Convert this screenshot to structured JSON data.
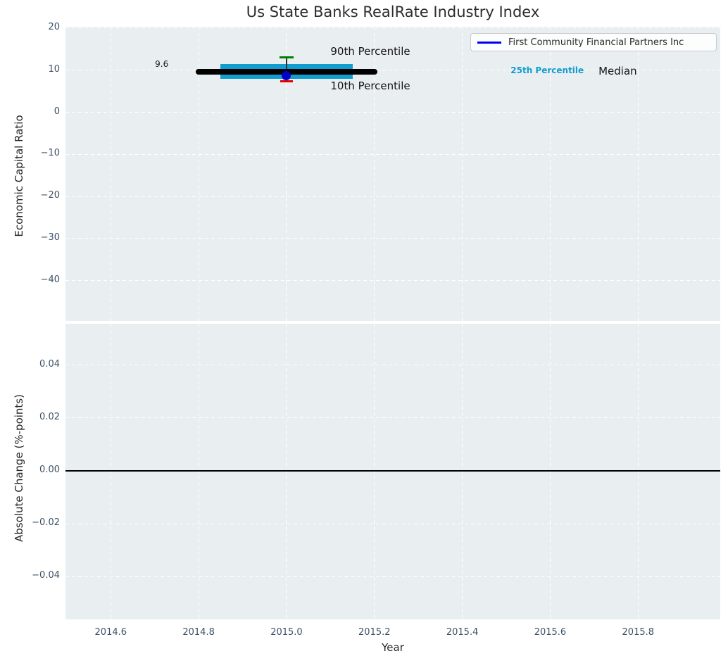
{
  "colors": {
    "plot_background": "#e9eef0",
    "grid": "#ffffff",
    "iqr_bar": "#109dd0",
    "median_line": "#000000",
    "p90_cap": "#008000",
    "p10_cap": "#e50000",
    "company_point": "#0000cd",
    "company_line": "#0000ee",
    "zero_line": "#000000",
    "whisker": "#2f2f2f"
  },
  "chart_data": [
    {
      "type": "box_timeline",
      "title": "Us State Banks RealRate Industry Index",
      "ylabel": "Economic Capital Ratio",
      "xlim": [
        2014.497,
        2015.987
      ],
      "ylim": [
        -49.6,
        20.33
      ],
      "grid": true,
      "legend": {
        "label": "First Community Financial Partners Inc",
        "position": "upper right"
      },
      "xticks": [
        {
          "v": 2014.6,
          "label": "2014.6"
        },
        {
          "v": 2014.8,
          "label": "2014.8"
        },
        {
          "v": 2015.0,
          "label": "2015.0"
        },
        {
          "v": 2015.2,
          "label": "2015.2"
        },
        {
          "v": 2015.4,
          "label": "2015.4"
        },
        {
          "v": 2015.6,
          "label": "2015.6"
        },
        {
          "v": 2015.8,
          "label": "2015.8"
        }
      ],
      "yticks": [
        {
          "v": 20,
          "label": "20"
        },
        {
          "v": 10,
          "label": "10"
        },
        {
          "v": 0,
          "label": "0"
        },
        {
          "v": -10,
          "label": "−10"
        },
        {
          "v": -20,
          "label": "−20"
        },
        {
          "v": -30,
          "label": "−30"
        },
        {
          "v": -40,
          "label": "−40"
        }
      ],
      "box": {
        "x": 2015.0,
        "median": {
          "value": 9.6,
          "x_from": 2014.8,
          "x_to": 2015.2
        },
        "iqr": {
          "p25": 8.0,
          "p75": 11.5,
          "x_from": 2014.85,
          "x_to": 2015.15
        },
        "whisker": {
          "p10": 7.4,
          "p90": 13.1
        },
        "point": {
          "x": 2015.0,
          "value": 8.7
        }
      },
      "annotations": [
        {
          "text": "9.6",
          "x": 2014.716,
          "y": 11.5,
          "align": "center",
          "style": "value"
        },
        {
          "text": "90th Percentile",
          "x": 2015.1,
          "y": 14.4,
          "align": "left",
          "style": "plain"
        },
        {
          "text": "10th Percentile",
          "x": 2015.1,
          "y": 6.3,
          "align": "left",
          "style": "plain"
        },
        {
          "text": "25th Percentile",
          "x": 2015.51,
          "y": 10.0,
          "align": "left",
          "style": "cyan"
        },
        {
          "text": "Median",
          "x": 2015.71,
          "y": 9.8,
          "align": "left",
          "style": "plain"
        }
      ]
    },
    {
      "type": "line",
      "ylabel": "Absolute Change (%-points)",
      "xlabel": "Year",
      "xlim": [
        2014.497,
        2015.987
      ],
      "ylim": [
        -0.0561,
        0.0556
      ],
      "grid": true,
      "zero_line": 0.0,
      "series": [],
      "xticks": [
        {
          "v": 2014.6,
          "label": "2014.6"
        },
        {
          "v": 2014.8,
          "label": "2014.8"
        },
        {
          "v": 2015.0,
          "label": "2015.0"
        },
        {
          "v": 2015.2,
          "label": "2015.2"
        },
        {
          "v": 2015.4,
          "label": "2015.4"
        },
        {
          "v": 2015.6,
          "label": "2015.6"
        },
        {
          "v": 2015.8,
          "label": "2015.8"
        }
      ],
      "yticks": [
        {
          "v": 0.04,
          "label": "0.04"
        },
        {
          "v": 0.02,
          "label": "0.02"
        },
        {
          "v": 0.0,
          "label": "0.00"
        },
        {
          "v": -0.02,
          "label": "−0.02"
        },
        {
          "v": -0.04,
          "label": "−0.04"
        }
      ]
    }
  ]
}
